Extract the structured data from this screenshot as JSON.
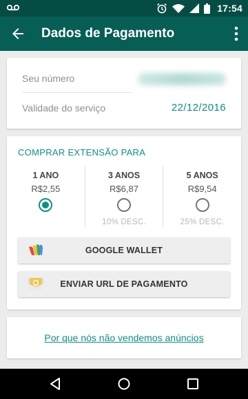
{
  "status_bar": {
    "time": "17:54"
  },
  "app_bar": {
    "title": "Dados de Pagamento"
  },
  "account": {
    "number_label": "Seu número",
    "validity_label": "Validade do serviço",
    "validity_date": "22/12/2016"
  },
  "purchase": {
    "heading": "COMPRAR EXTENSÃO PARA",
    "plans": [
      {
        "duration": "1 ANO",
        "price": "R$2,55",
        "discount": "",
        "selected": true
      },
      {
        "duration": "3 ANOS",
        "price": "R$6,87",
        "discount": "10% DESC.",
        "selected": false
      },
      {
        "duration": "5 ANOS",
        "price": "R$9,54",
        "discount": "25% DESC.",
        "selected": false
      }
    ],
    "google_wallet_label": "GOOGLE WALLET",
    "send_url_label": "ENVIAR URL DE PAGAMENTO"
  },
  "ads_link": "Por que nós não vendemos anúncios",
  "colors": {
    "app_bar": "#075e54",
    "status_bar": "#054d44",
    "accent": "#0d8f83"
  }
}
